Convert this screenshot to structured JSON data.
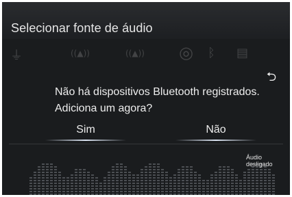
{
  "header": {
    "title": "Selecionar fonte de áudio"
  },
  "dialog": {
    "message_line1": "Não há dispositivos Bluetooth registrados.",
    "message_line2": "Adiciona um agora?",
    "yes_label": "Sim",
    "no_label": "Não"
  },
  "sources": [
    {
      "icon": "usb-plug-icon",
      "glyph": "⏚"
    },
    {
      "icon": "am-radio-icon",
      "glyph": "((▲))"
    },
    {
      "icon": "fm-radio-icon",
      "glyph": "((▲))"
    },
    {
      "icon": "disc-icon",
      "glyph": "◎"
    },
    {
      "icon": "bluetooth-icon",
      "glyph": "ᛒ"
    },
    {
      "icon": "aux-icon",
      "glyph": "▤"
    }
  ],
  "back": {
    "icon": "back-arrow-icon",
    "glyph": "⮌"
  },
  "status": {
    "text": "Áudio desligado"
  },
  "colors": {
    "background": "#1a1c1e",
    "text": "#eeeeee",
    "accent": "#dfe8ff"
  }
}
